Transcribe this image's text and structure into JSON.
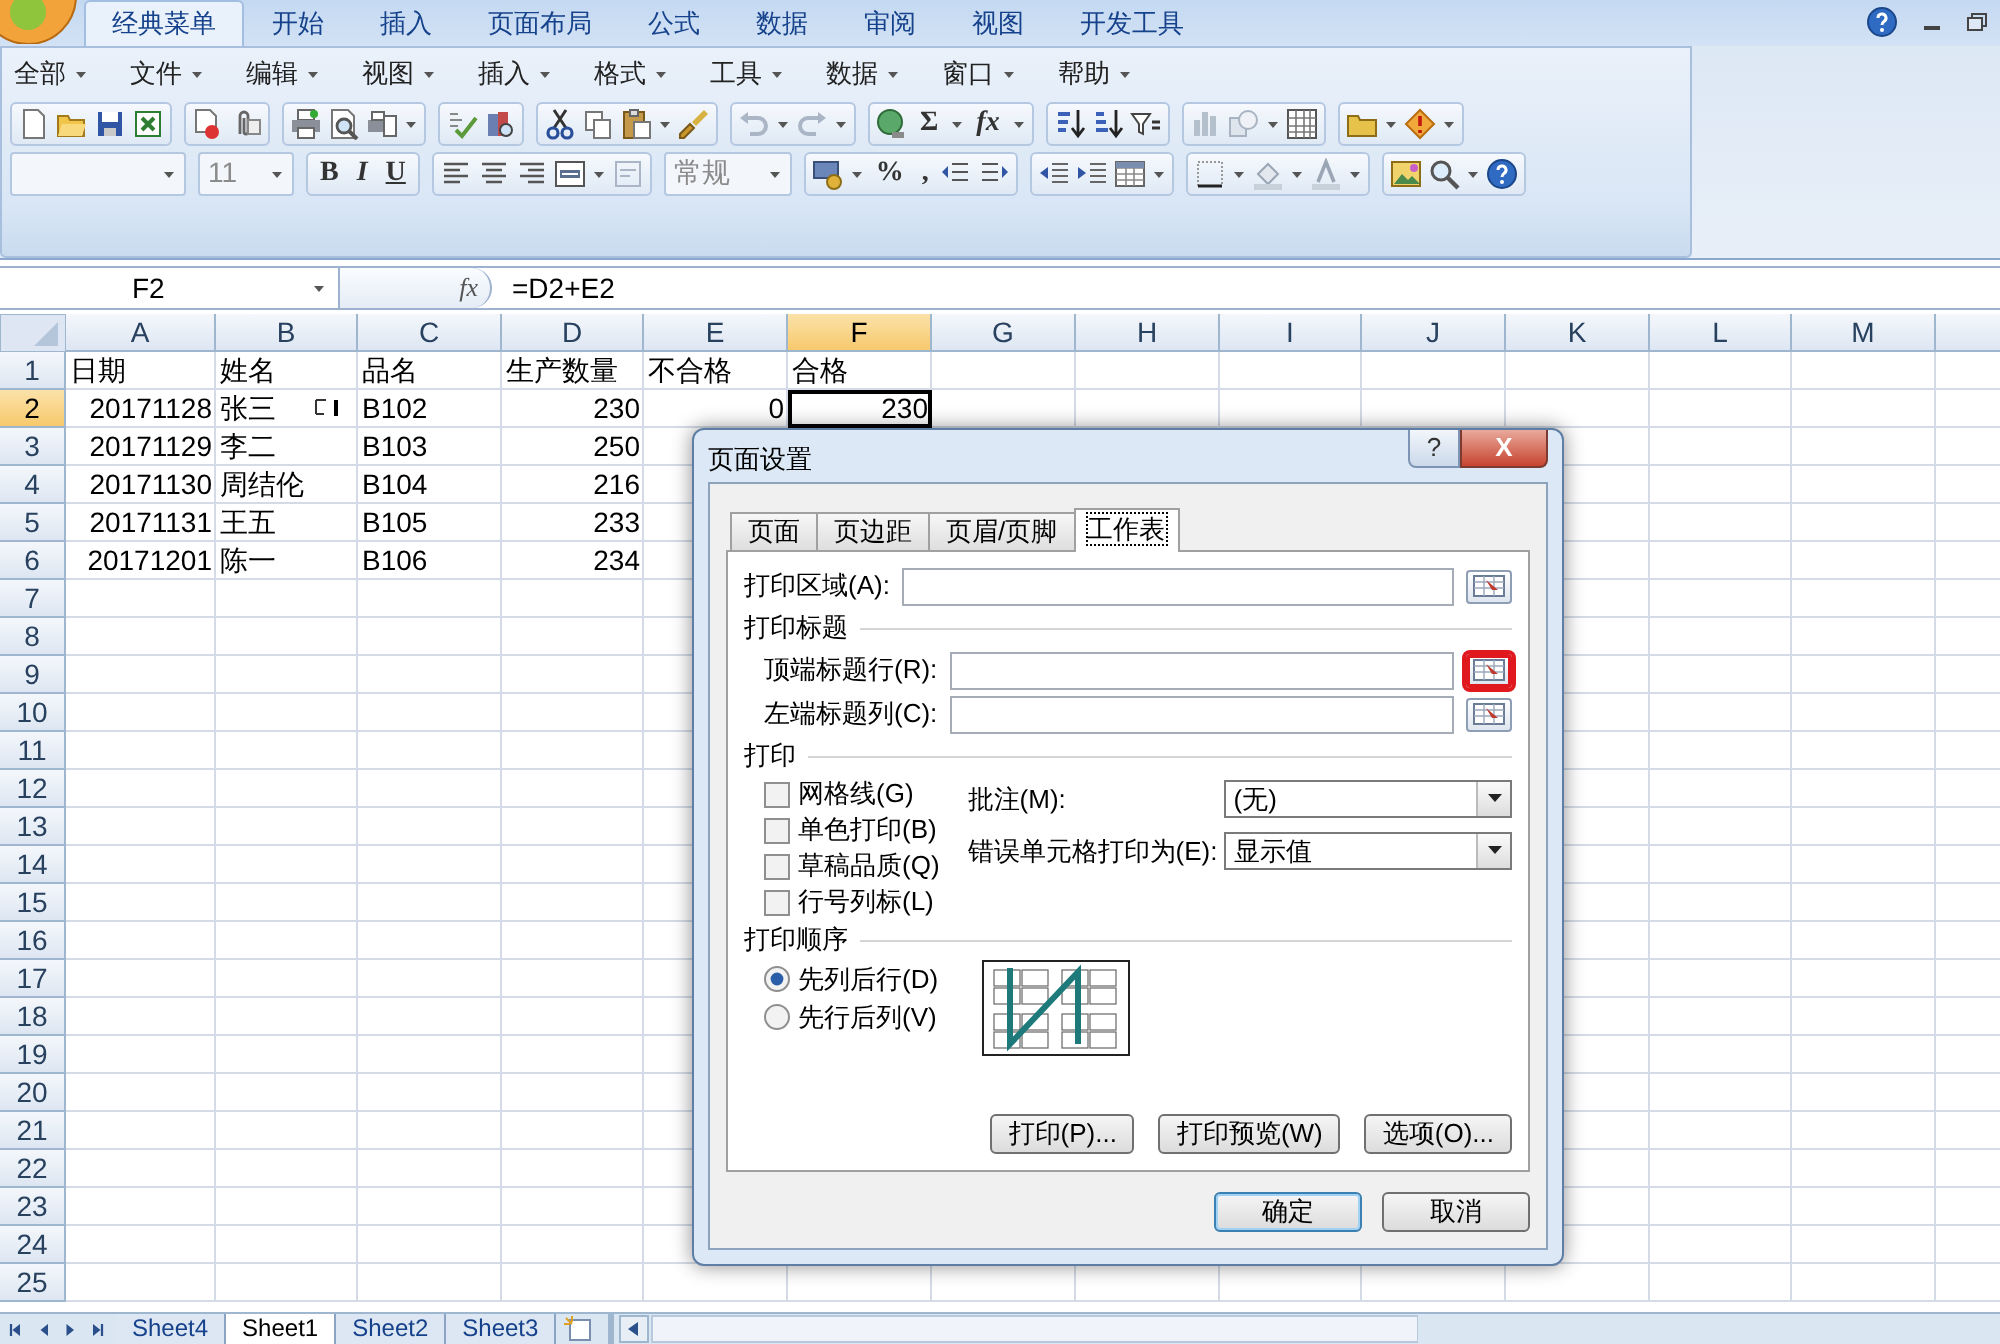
{
  "ribbon_tabs": [
    {
      "label": "经典菜单",
      "selected": true
    },
    {
      "label": "开始",
      "selected": false
    },
    {
      "label": "插入",
      "selected": false
    },
    {
      "label": "页面布局",
      "selected": false
    },
    {
      "label": "公式",
      "selected": false
    },
    {
      "label": "数据",
      "selected": false
    },
    {
      "label": "审阅",
      "selected": false
    },
    {
      "label": "视图",
      "selected": false
    },
    {
      "label": "开发工具",
      "selected": false
    }
  ],
  "menu": [
    "全部",
    "文件",
    "编辑",
    "视图",
    "插入",
    "格式",
    "工具",
    "数据",
    "窗口",
    "帮助"
  ],
  "toolbar": {
    "sum": "Σ",
    "function": "fx",
    "font_size": "11",
    "bold": "B",
    "italic": "I",
    "underline": "U",
    "number_format": "常规",
    "percent": "%",
    "comma": ","
  },
  "formula_bar": {
    "name_box": "F2",
    "fx": "fx",
    "formula": "=D2+E2"
  },
  "sheet": {
    "columns": [
      {
        "label": "A",
        "selected": false
      },
      {
        "label": "B",
        "selected": false
      },
      {
        "label": "C",
        "selected": false
      },
      {
        "label": "D",
        "selected": false
      },
      {
        "label": "E",
        "selected": false
      },
      {
        "label": "F",
        "selected": true
      },
      {
        "label": "G",
        "selected": false
      },
      {
        "label": "H",
        "selected": false
      },
      {
        "label": "I",
        "selected": false
      },
      {
        "label": "J",
        "selected": false
      },
      {
        "label": "K",
        "selected": false
      },
      {
        "label": "L",
        "selected": false
      },
      {
        "label": "M",
        "selected": false
      }
    ],
    "rows": [
      {
        "label": "1",
        "selected": false,
        "cells": [
          {
            "text": "日期",
            "kind": "text"
          },
          {
            "text": "姓名",
            "kind": "text"
          },
          {
            "text": "品名",
            "kind": "text"
          },
          {
            "text": "生产数量",
            "kind": "text"
          },
          {
            "text": "不合格",
            "kind": "text"
          },
          {
            "text": "合格",
            "kind": "text"
          }
        ]
      },
      {
        "label": "2",
        "selected": true,
        "cells": [
          {
            "text": "20171128",
            "kind": "number"
          },
          {
            "text": "张三",
            "kind": "text"
          },
          {
            "text": "B102",
            "kind": "text"
          },
          {
            "text": "230",
            "kind": "number"
          },
          {
            "text": "0",
            "kind": "number"
          },
          {
            "text": "230",
            "kind": "number"
          }
        ]
      },
      {
        "label": "3",
        "selected": false,
        "cells": [
          {
            "text": "20171129",
            "kind": "number"
          },
          {
            "text": "李二",
            "kind": "text"
          },
          {
            "text": "B103",
            "kind": "text"
          },
          {
            "text": "250",
            "kind": "number"
          }
        ]
      },
      {
        "label": "4",
        "selected": false,
        "cells": [
          {
            "text": "20171130",
            "kind": "number"
          },
          {
            "text": "周结伦",
            "kind": "text"
          },
          {
            "text": "B104",
            "kind": "text"
          },
          {
            "text": "216",
            "kind": "number"
          }
        ]
      },
      {
        "label": "5",
        "selected": false,
        "cells": [
          {
            "text": "20171131",
            "kind": "number"
          },
          {
            "text": "王五",
            "kind": "text"
          },
          {
            "text": "B105",
            "kind": "text"
          },
          {
            "text": "233",
            "kind": "number"
          }
        ]
      },
      {
        "label": "6",
        "selected": false,
        "cells": [
          {
            "text": "20171201",
            "kind": "number"
          },
          {
            "text": "陈一",
            "kind": "text"
          },
          {
            "text": "B106",
            "kind": "text"
          },
          {
            "text": "234",
            "kind": "number"
          }
        ]
      },
      {
        "label": "7",
        "selected": false
      },
      {
        "label": "8",
        "selected": false
      },
      {
        "label": "9",
        "selected": false
      },
      {
        "label": "10",
        "selected": false
      },
      {
        "label": "11",
        "selected": false
      },
      {
        "label": "12",
        "selected": false
      },
      {
        "label": "13",
        "selected": false
      },
      {
        "label": "14",
        "selected": false
      },
      {
        "label": "15",
        "selected": false
      },
      {
        "label": "16",
        "selected": false
      },
      {
        "label": "17",
        "selected": false
      },
      {
        "label": "18",
        "selected": false
      },
      {
        "label": "19",
        "selected": false
      },
      {
        "label": "20",
        "selected": false
      },
      {
        "label": "21",
        "selected": false
      },
      {
        "label": "22",
        "selected": false
      },
      {
        "label": "23",
        "selected": false
      },
      {
        "label": "24",
        "selected": false
      },
      {
        "label": "25",
        "selected": false
      }
    ]
  },
  "dialog": {
    "title": "页面设置",
    "help_button": "?",
    "close_button": "X",
    "tabs": [
      {
        "label": "页面",
        "selected": false
      },
      {
        "label": "页边距",
        "selected": false
      },
      {
        "label": "页眉/页脚",
        "selected": false
      },
      {
        "label": "工作表",
        "selected": true
      }
    ],
    "print_area": {
      "label": "打印区域(A):"
    },
    "print_titles": {
      "heading": "打印标题",
      "fields": [
        {
          "label": "顶端标题行(R):",
          "highlighted": true
        },
        {
          "label": "左端标题列(C):",
          "highlighted": false
        }
      ]
    },
    "print": {
      "heading": "打印",
      "checkboxes": [
        {
          "label": "网格线(G)",
          "checked": false
        },
        {
          "label": "单色打印(B)",
          "checked": false
        },
        {
          "label": "草稿品质(Q)",
          "checked": false
        },
        {
          "label": "行号列标(L)",
          "checked": false
        }
      ],
      "dropdowns": [
        {
          "label": "批注(M):",
          "value": "(无)"
        },
        {
          "label": "错误单元格打印为(E):",
          "value": "显示值"
        }
      ]
    },
    "page_order": {
      "heading": "打印顺序",
      "options": [
        {
          "label": "先列后行(D)",
          "selected": true
        },
        {
          "label": "先行后列(V)",
          "selected": false
        }
      ]
    },
    "buttons": [
      "打印(P)...",
      "打印预览(W)",
      "选项(O)..."
    ],
    "footer_buttons": [
      {
        "label": "确定",
        "default": true
      },
      {
        "label": "取消",
        "default": false
      }
    ]
  },
  "sheet_tabs": [
    {
      "label": "Sheet4",
      "selected": false
    },
    {
      "label": "Sheet1",
      "selected": true
    },
    {
      "label": "Sheet2",
      "selected": false
    },
    {
      "label": "Sheet3",
      "selected": false
    }
  ]
}
